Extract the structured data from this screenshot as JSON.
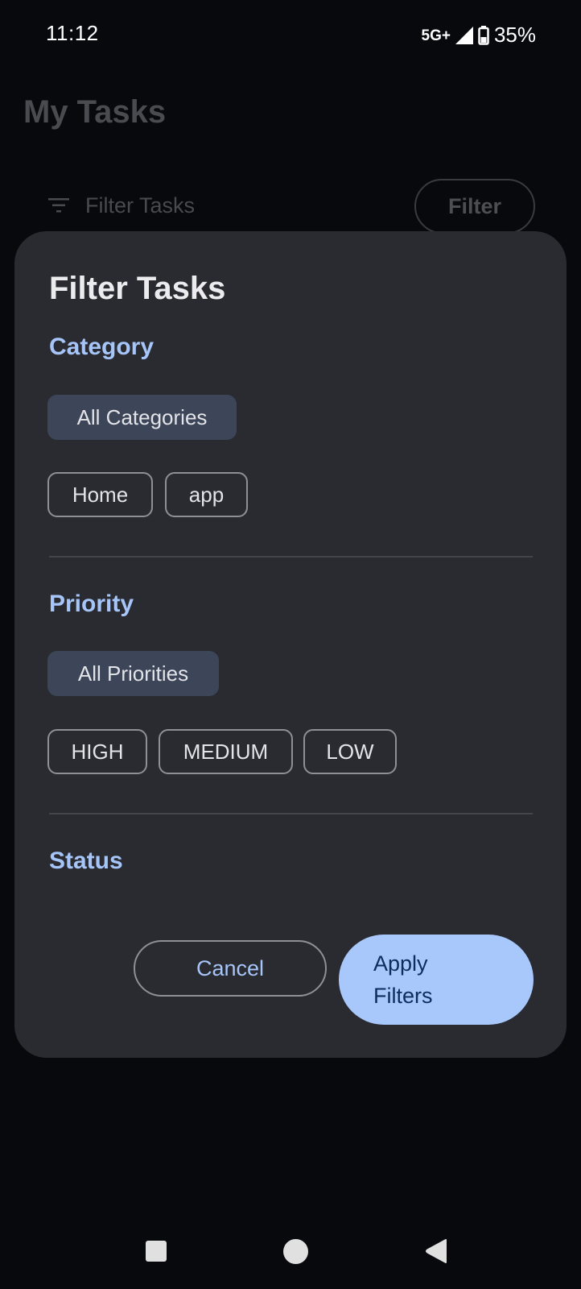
{
  "status_bar": {
    "time": "11:12",
    "network": "5G+",
    "battery": "35%",
    "icons": [
      "signal-icon",
      "battery-icon"
    ]
  },
  "app": {
    "title": "My Tasks",
    "filter_placeholder": "Filter Tasks",
    "filter_button": "Filter"
  },
  "dialog": {
    "title": "Filter Tasks",
    "category": {
      "label": "Category",
      "all_label": "All Categories",
      "options": [
        "Home",
        "app"
      ]
    },
    "priority": {
      "label": "Priority",
      "all_label": "All Priorities",
      "options": [
        "HIGH",
        "MEDIUM",
        "LOW"
      ]
    },
    "status": {
      "label": "Status"
    },
    "cancel_label": "Cancel",
    "apply_label": "Apply Filters",
    "apply_label_line1": "Apply",
    "apply_label_line2": "Filters"
  },
  "colors": {
    "accent": "#a6c5f9",
    "dialog_bg": "#2a2b31",
    "selected_chip": "#3d4559",
    "apply_bg": "#a8c7fb"
  },
  "nav_bar": {
    "icons": [
      "recents-square-icon",
      "home-circle-icon",
      "back-triangle-icon"
    ]
  }
}
